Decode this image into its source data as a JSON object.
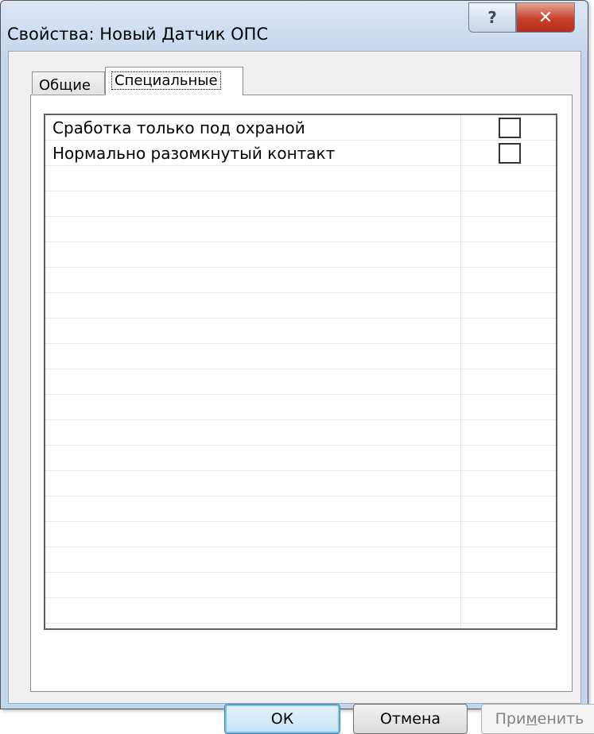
{
  "window": {
    "title": "Свойства: Новый Датчик ОПС",
    "help_glyph": "?",
    "close_glyph": "✕"
  },
  "tabs": [
    {
      "label": "Общие",
      "active": false
    },
    {
      "label": "Специальные",
      "active": true
    }
  ],
  "properties": [
    {
      "label": "Сработка только под охраной",
      "checked": false
    },
    {
      "label": "Нормально разомкнутый контакт",
      "checked": false
    }
  ],
  "buttons": {
    "ok": "ОК",
    "cancel": "Отмена",
    "apply_pre": "При",
    "apply_accel": "м",
    "apply_post": "енить"
  },
  "colors": {
    "close_button": "#c8402a",
    "default_button_border": "#3c7fb1",
    "frame": "#c2d6ec"
  }
}
